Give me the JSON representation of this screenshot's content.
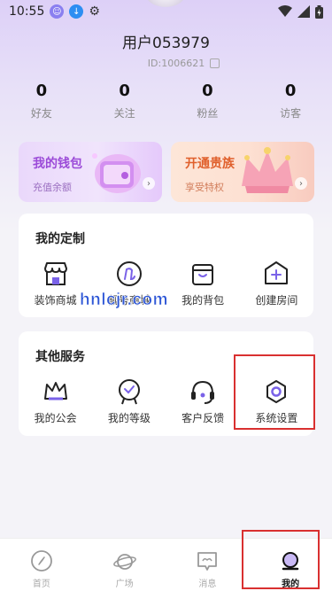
{
  "status_bar": {
    "time": "10:55"
  },
  "profile": {
    "username": "用户053979",
    "user_id": "ID:1006621"
  },
  "stats": [
    {
      "value": "0",
      "label": "好友"
    },
    {
      "value": "0",
      "label": "关注"
    },
    {
      "value": "0",
      "label": "粉丝"
    },
    {
      "value": "0",
      "label": "访客"
    }
  ],
  "promos": {
    "wallet": {
      "title": "我的钱包",
      "subtitle": "充值余额"
    },
    "vip": {
      "title": "开通贵族",
      "subtitle": "享受特权"
    }
  },
  "custom_section": {
    "title": "我的定制",
    "items": [
      {
        "label": "装饰商城",
        "icon": "shop-icon"
      },
      {
        "label": "靓号商城",
        "icon": "pretty-number-icon"
      },
      {
        "label": "我的背包",
        "icon": "backpack-icon"
      },
      {
        "label": "创建房间",
        "icon": "create-room-icon"
      }
    ]
  },
  "services_section": {
    "title": "其他服务",
    "items": [
      {
        "label": "我的公会",
        "icon": "crown-icon"
      },
      {
        "label": "我的等级",
        "icon": "level-badge-icon"
      },
      {
        "label": "客户反馈",
        "icon": "headset-icon"
      },
      {
        "label": "系统设置",
        "icon": "settings-icon"
      }
    ]
  },
  "watermark": "hnlcjr.com",
  "tabbar": [
    {
      "label": "首页",
      "icon": "compass-icon",
      "active": false
    },
    {
      "label": "广场",
      "icon": "planet-icon",
      "active": false
    },
    {
      "label": "消息",
      "icon": "message-icon",
      "active": false
    },
    {
      "label": "我的",
      "icon": "profile-icon",
      "active": true
    }
  ],
  "colors": {
    "accent": "#9b4ad8",
    "vip": "#e0602c",
    "highlight": "#d93030"
  }
}
